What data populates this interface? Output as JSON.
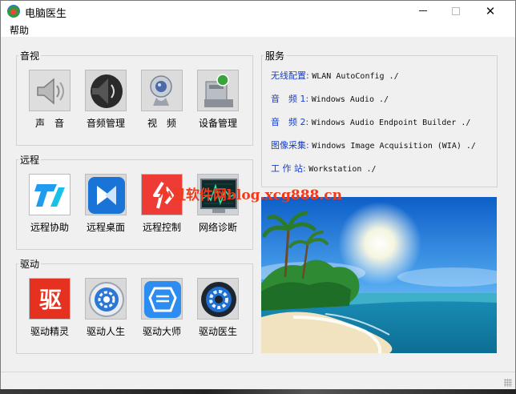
{
  "window": {
    "title": "电脑医生",
    "controls": {
      "minimize": "minimize",
      "maximize": "maximize",
      "close": "✕"
    }
  },
  "menubar": {
    "items": [
      "帮助"
    ]
  },
  "groups": {
    "media": {
      "title": "音视",
      "items": [
        {
          "label": "声　音",
          "icon": "speaker-icon"
        },
        {
          "label": "音频管理",
          "icon": "audio-manager-icon"
        },
        {
          "label": "视　频",
          "icon": "webcam-icon"
        },
        {
          "label": "设备管理",
          "icon": "device-manager-icon"
        }
      ]
    },
    "remote": {
      "title": "远程",
      "items": [
        {
          "label": "远程协助",
          "icon": "todesk-icon"
        },
        {
          "label": "远程桌面",
          "icon": "remote-desktop-icon"
        },
        {
          "label": "远程控制",
          "icon": "remote-control-icon"
        },
        {
          "label": "网络诊断",
          "icon": "network-monitor-icon"
        }
      ]
    },
    "driver": {
      "title": "驱动",
      "items": [
        {
          "label": "驱动精灵",
          "icon": "driver-genius-icon"
        },
        {
          "label": "驱动人生",
          "icon": "driver-life-icon"
        },
        {
          "label": "驱动大师",
          "icon": "driver-master-icon"
        },
        {
          "label": "驱动医生",
          "icon": "driver-doctor-icon"
        }
      ]
    },
    "services": {
      "title": "服务",
      "rows": [
        {
          "key": "无线配置:",
          "value": "WLAN AutoConfig ./"
        },
        {
          "key": "音　频 1:",
          "value": "Windows Audio ./"
        },
        {
          "key": "音　频 2:",
          "value": "Windows Audio Endpoint Builder ./"
        },
        {
          "key": "图像采集:",
          "value": "Windows Image Acquisition (WIA) ./"
        },
        {
          "key": "工 作 站:",
          "value": "Workstation ./"
        }
      ]
    }
  },
  "watermark": "小丑软件网blog.xcg888.cn",
  "colors": {
    "service_key": "#1a3ec8",
    "watermark": "#f23a1a",
    "window_bg": "#f0f0f0"
  }
}
